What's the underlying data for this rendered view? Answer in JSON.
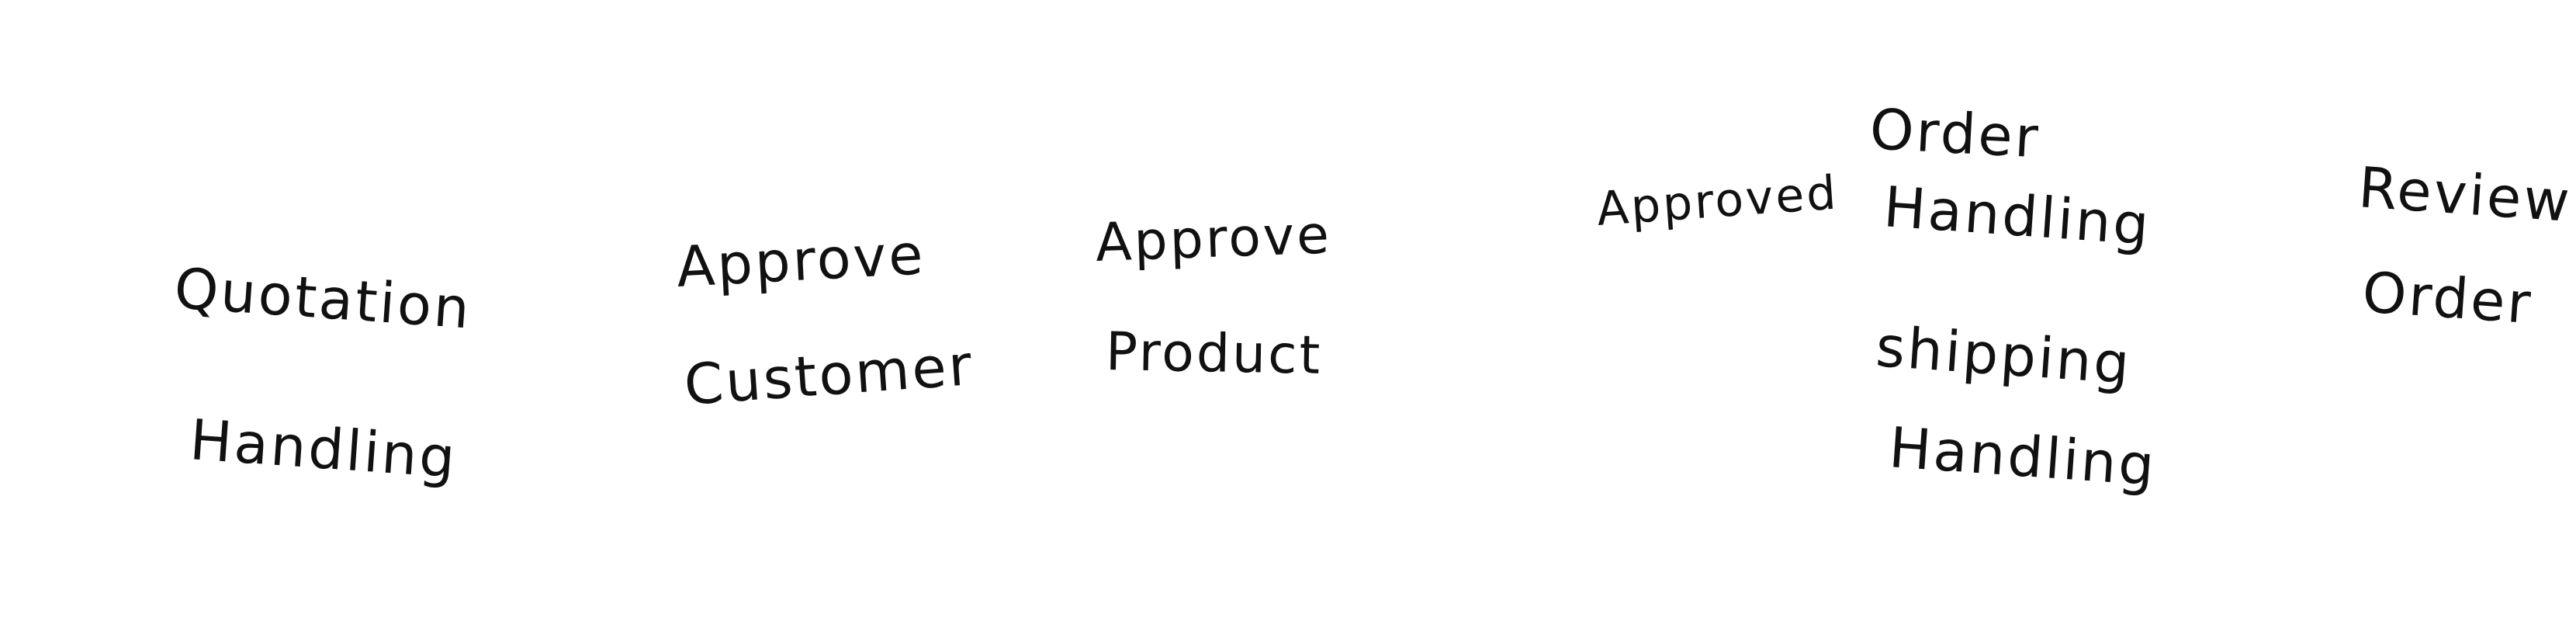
{
  "diagram": {
    "nodes": [
      {
        "id": "quotation-handling",
        "lines": [
          "Quotation",
          "Handling"
        ]
      },
      {
        "id": "approve-customer",
        "lines": [
          "Approve",
          "Customer"
        ]
      },
      {
        "id": "approve-product",
        "lines": [
          "Approve",
          "Product"
        ]
      },
      {
        "id": "approved",
        "lines": [
          "Approved"
        ]
      },
      {
        "id": "order-handling",
        "lines": [
          "Order",
          "Handling"
        ]
      },
      {
        "id": "shipping-handling",
        "lines": [
          "shipping",
          "Handling"
        ]
      },
      {
        "id": "review-order",
        "lines": [
          "Review",
          "Order"
        ]
      }
    ]
  }
}
